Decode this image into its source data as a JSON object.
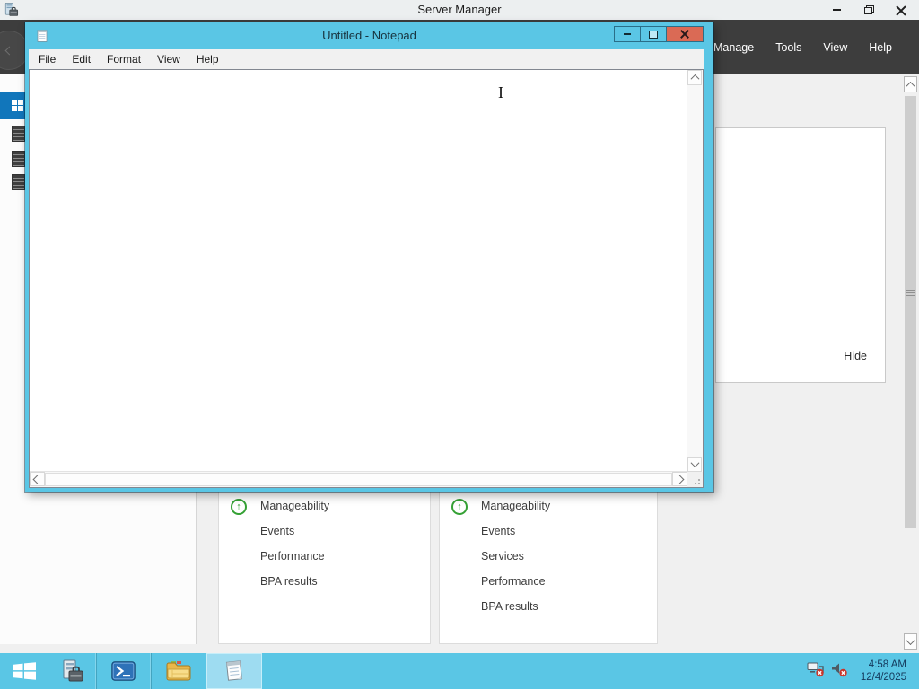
{
  "server_manager": {
    "window_title": "Server Manager",
    "menu": {
      "items": [
        "Manage",
        "Tools",
        "View",
        "Help"
      ]
    },
    "dashboard": {
      "welcome_tile": {
        "hide_label": "Hide"
      },
      "role_tiles": [
        {
          "rows": [
            "Manageability",
            "Events",
            "Performance",
            "BPA results"
          ]
        },
        {
          "rows": [
            "Manageability",
            "Events",
            "Services",
            "Performance",
            "BPA results"
          ]
        }
      ]
    }
  },
  "notepad": {
    "window_title": "Untitled - Notepad",
    "menu": {
      "items": [
        "File",
        "Edit",
        "Format",
        "View",
        "Help"
      ]
    },
    "text_content": ""
  },
  "taskbar": {
    "clock": {
      "time": "4:58 AM",
      "date": "12/4/2025"
    }
  },
  "icons": {
    "server_manager_app": "server-with-toolbox",
    "notepad_app": "notepad-page",
    "start": "windows-flag",
    "powershell": "blue-terminal-arrow",
    "file_explorer": "yellow-folder",
    "network_tray": "network-with-error-x",
    "volume_tray": "speaker-with-error-x",
    "tile_status": "green-circle-up-arrow"
  },
  "colors": {
    "accent_cyan": "#5ac6e5",
    "close_red": "#da6a55",
    "selected_blue": "#1176bb",
    "status_green": "#35a135",
    "header_dark": "#3d3d3d",
    "dashboard_bg": "#f0f0f0"
  }
}
